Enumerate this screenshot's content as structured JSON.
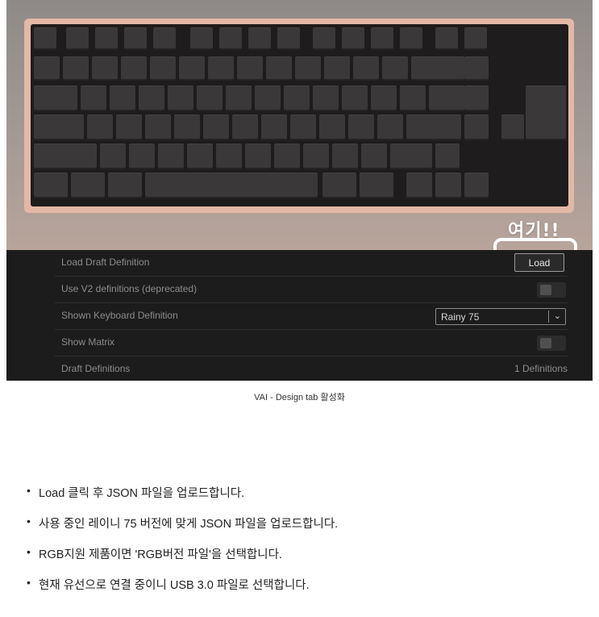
{
  "figure": {
    "callout_text": "여기!!",
    "settings": [
      {
        "label": "Load Draft Definition",
        "control": "button",
        "button_label": "Load"
      },
      {
        "label": "Use V2 definitions (deprecated)",
        "control": "toggle",
        "checked": false
      },
      {
        "label": "Shown Keyboard Definition",
        "control": "select",
        "selected": "Rainy 75"
      },
      {
        "label": "Show Matrix",
        "control": "toggle",
        "checked": false
      },
      {
        "label": "Draft Definitions",
        "control": "text",
        "value": "1 Definitions"
      }
    ],
    "colors": {
      "case": "#e4b8a6",
      "plate": "#1e1c1c",
      "keycap": "#3a3838",
      "panel": "#1c1c1c",
      "highlight": "#ffffff"
    }
  },
  "caption": "VAI - Design tab 활성화",
  "notes": [
    "Load 클릭 후 JSON 파일을 업로드합니다.",
    "사용 중인 레이니 75 버전에 맞게 JSON 파일을 업로드합니다.",
    "RGB지원 제품이면 'RGB버전 파일'을 선택합니다.",
    "현재 유선으로 연결 중이니 USB 3.0 파일로 선택합니다."
  ]
}
